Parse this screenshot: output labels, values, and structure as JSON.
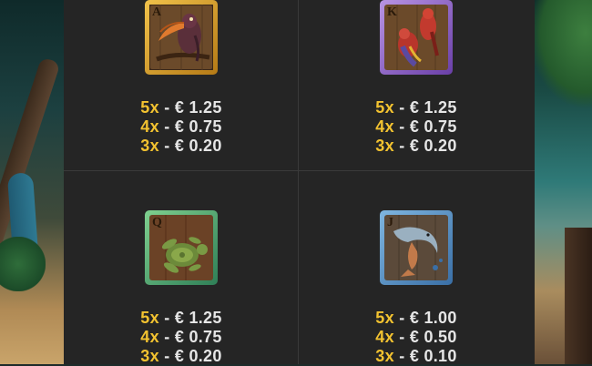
{
  "paytable": [
    {
      "symbol": "A",
      "icon": "toucan-icon",
      "frame_color": "#d9a22c",
      "payouts": [
        {
          "mult": "5x",
          "value": "- € 1.25"
        },
        {
          "mult": "4x",
          "value": "- € 0.75"
        },
        {
          "mult": "3x",
          "value": "- € 0.20"
        }
      ]
    },
    {
      "symbol": "K",
      "icon": "parrot-icon",
      "frame_color": "#9b6ccf",
      "payouts": [
        {
          "mult": "5x",
          "value": "- € 1.25"
        },
        {
          "mult": "4x",
          "value": "- € 0.75"
        },
        {
          "mult": "3x",
          "value": "- € 0.20"
        }
      ]
    },
    {
      "symbol": "Q",
      "icon": "turtle-icon",
      "frame_color": "#4fb078",
      "payouts": [
        {
          "mult": "5x",
          "value": "- € 1.25"
        },
        {
          "mult": "4x",
          "value": "- € 0.75"
        },
        {
          "mult": "3x",
          "value": "- € 0.20"
        }
      ]
    },
    {
      "symbol": "J",
      "icon": "dolphin-icon",
      "frame_color": "#5a93c9",
      "payouts": [
        {
          "mult": "5x",
          "value": "- € 1.00"
        },
        {
          "mult": "4x",
          "value": "- € 0.50"
        },
        {
          "mult": "3x",
          "value": "- € 0.10"
        }
      ]
    }
  ],
  "colors": {
    "multiplier": "#f2c230",
    "value_text": "#e6e6e6",
    "panel": "#252525"
  }
}
